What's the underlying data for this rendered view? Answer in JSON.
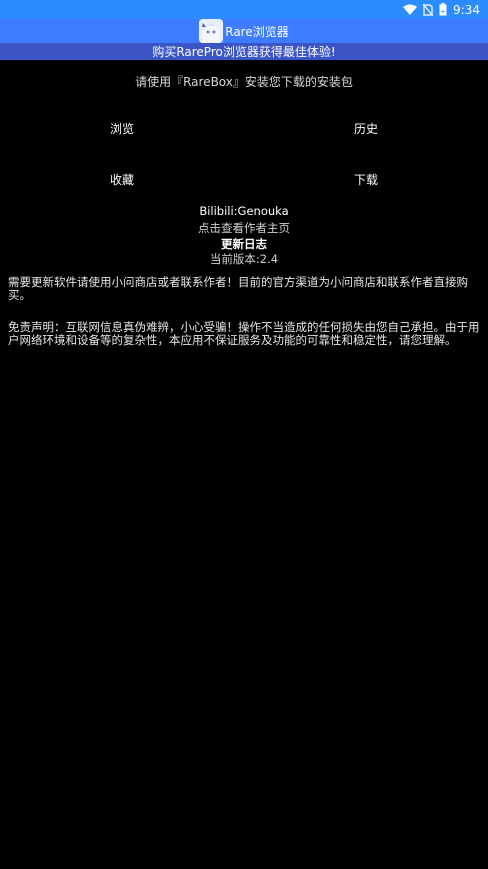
{
  "status_bar": {
    "time": "9:34",
    "icons": [
      "wifi-icon",
      "no-sim-icon",
      "battery-icon"
    ]
  },
  "app_bar": {
    "title": "Rare浏览器",
    "logo": "anime-avatar-logo"
  },
  "banner": {
    "text": "购买RarePro浏览器获得最佳体验!"
  },
  "hint": {
    "text": "请使用『RareBox』安装您下载的安装包"
  },
  "nav": {
    "browse": "浏览",
    "history": "历史",
    "favorites": "收藏",
    "downloads": "下载"
  },
  "author": {
    "handle": "Bilibili:Genouka",
    "homepage_link": "点击查看作者主页",
    "changelog": "更新日志",
    "version": "当前版本:2.4"
  },
  "notice": {
    "update": "需要更新软件请使用小问商店或者联系作者！目前的官方渠道为小问商店和联系作者直接购买。",
    "disclaimer": "免责声明：互联网信息真伪难辨，小心受骗！操作不当造成的任何损失由您自己承担。由于用户网络环境和设备等的复杂性，本应用不保证服务及功能的可靠性和稳定性，请您理解。"
  },
  "colors": {
    "status_bar": "#2b8cff",
    "app_bar": "#3d7bff",
    "banner": "#3b55c6",
    "background": "#000000"
  }
}
